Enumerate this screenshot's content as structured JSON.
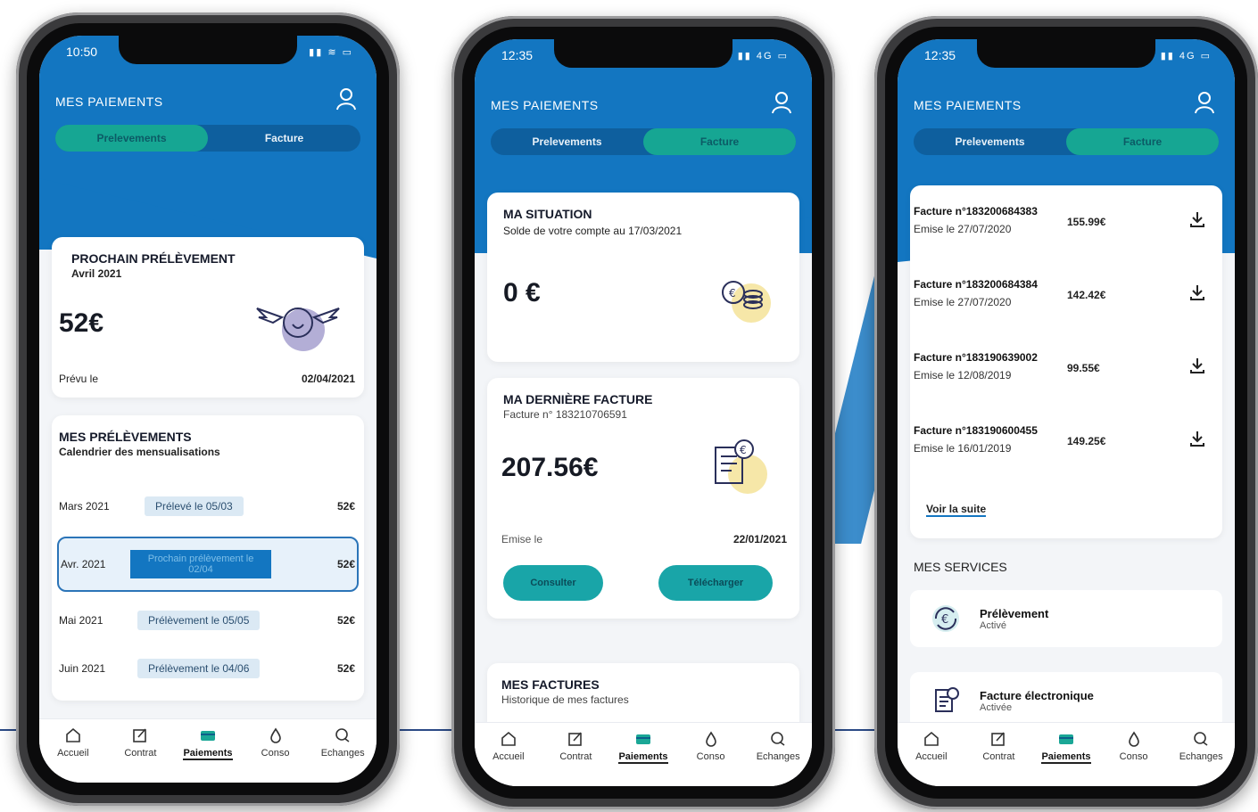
{
  "phones": [
    {
      "time": "10:50",
      "title": "MES PAIEMENTS",
      "tabs": [
        "Prelevements",
        "Facture"
      ],
      "active_tab": 0,
      "next": {
        "title": "PROCHAIN PRÉLÈVEMENT",
        "month": "Avril 2021",
        "amount": "52€",
        "planned_label": "Prévu le",
        "planned_date": "02/04/2021"
      },
      "schedule": {
        "title": "MES PRÉLÈVEMENTS",
        "subtitle": "Calendrier des mensualisations",
        "rows": [
          {
            "month": "Mars 2021",
            "status": "Prélevé le 05/03",
            "amount": "52€"
          },
          {
            "month": "Avr. 2021",
            "status": "Prochain prélèvement le 02/04",
            "amount": "52€"
          },
          {
            "month": "Mai 2021",
            "status": "Prélèvement le 05/05",
            "amount": "52€"
          },
          {
            "month": "Juin 2021",
            "status": "Prélèvement le 04/06",
            "amount": "52€"
          }
        ]
      }
    },
    {
      "time": "12:35",
      "title": "MES PAIEMENTS",
      "tabs": [
        "Prelevements",
        "Facture"
      ],
      "active_tab": 1,
      "situation": {
        "title": "MA SITUATION",
        "subtitle": "Solde de votre compte au 17/03/2021",
        "amount": "0 €"
      },
      "last_invoice": {
        "title": "MA DERNIÈRE FACTURE",
        "number": "Facture n° 183210706591",
        "amount": "207.56€",
        "issued_label": "Emise le",
        "issued_date": "22/01/2021",
        "btn_view": "Consulter",
        "btn_download": "Télécharger"
      },
      "invoices": {
        "title": "MES FACTURES",
        "subtitle": "Historique de mes factures"
      }
    },
    {
      "time": "12:35",
      "title": "MES PAIEMENTS",
      "tabs": [
        "Prelevements",
        "Facture"
      ],
      "active_tab": 1,
      "invoice_list": [
        {
          "number": "Facture n°183200684383",
          "date": "Emise le 27/07/2020",
          "amount": "155.99€"
        },
        {
          "number": "Facture n°183200684384",
          "date": "Emise le 27/07/2020",
          "amount": "142.42€"
        },
        {
          "number": "Facture n°183190639002",
          "date": "Emise le 12/08/2019",
          "amount": "99.55€"
        },
        {
          "number": "Facture n°183190600455",
          "date": "Emise le 16/01/2019",
          "amount": "149.25€"
        }
      ],
      "more": "Voir la suite",
      "services_title": "MES SERVICES",
      "services": [
        {
          "title": "Prélèvement",
          "status": "Activé"
        },
        {
          "title": "Facture électronique",
          "status": "Activée"
        }
      ]
    }
  ],
  "nav": [
    "Accueil",
    "Contrat",
    "Paiements",
    "Conso",
    "Echanges"
  ],
  "colors": {
    "header": "#1376c1",
    "accent": "#16a693",
    "dark_tab": "#0e5f9e"
  }
}
